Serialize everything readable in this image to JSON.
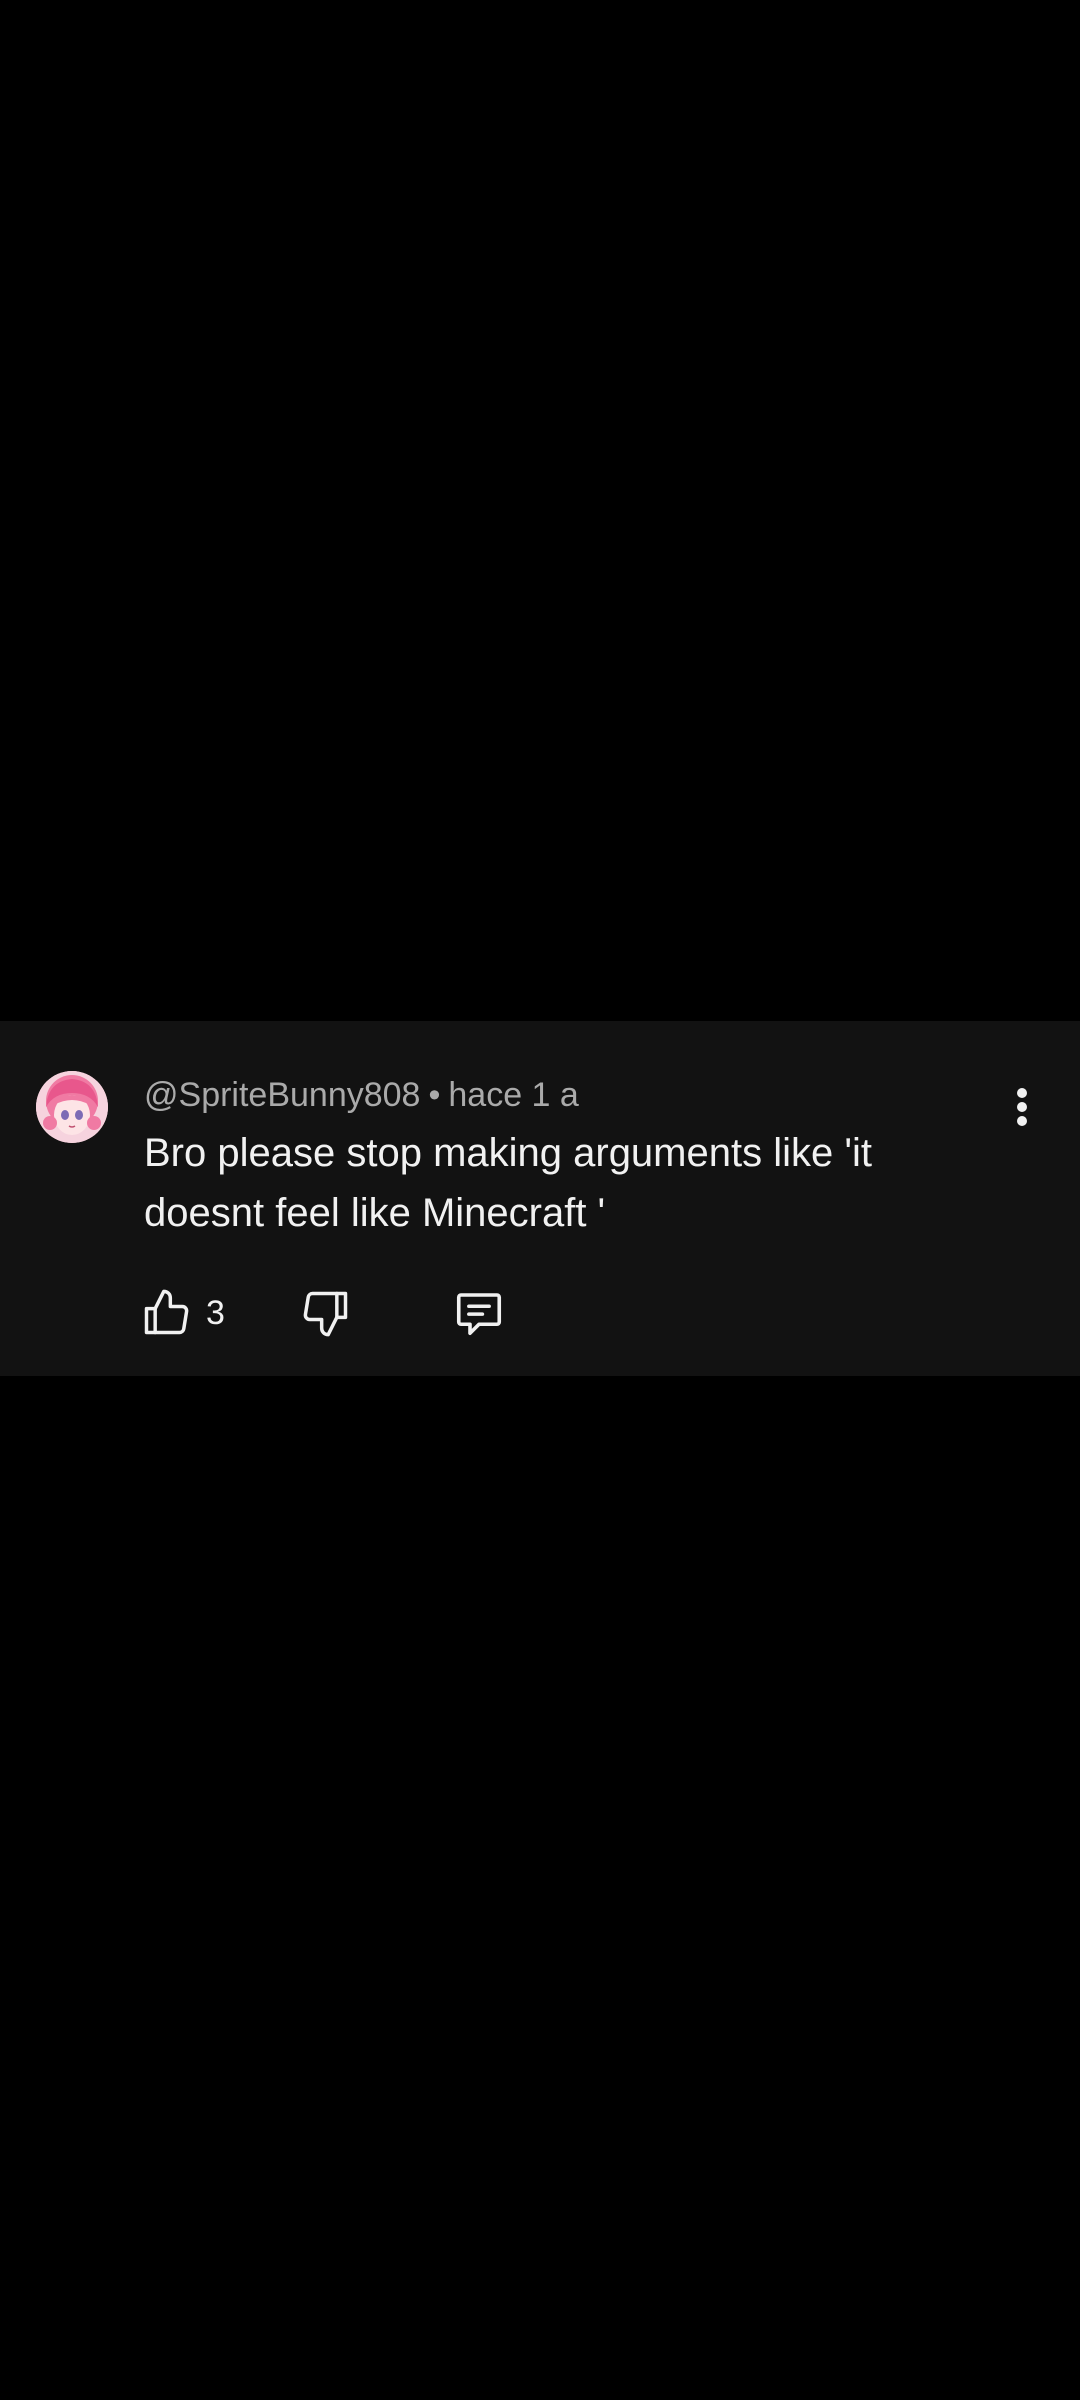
{
  "comment": {
    "username": "@SpriteBunny808",
    "separator": "•",
    "timestamp": "hace 1 a",
    "text": "Bro please stop making arguments like 'it doesnt feel like Minecraft '",
    "like_count": "3"
  },
  "icons": {
    "more": "more-vert-icon",
    "like": "thumbs-up-icon",
    "dislike": "thumbs-down-icon",
    "reply": "reply-comment-icon"
  },
  "colors": {
    "background": "#000000",
    "card": "#121212",
    "primary_text": "#f1f1f1",
    "secondary_text": "#aaaaaa"
  }
}
